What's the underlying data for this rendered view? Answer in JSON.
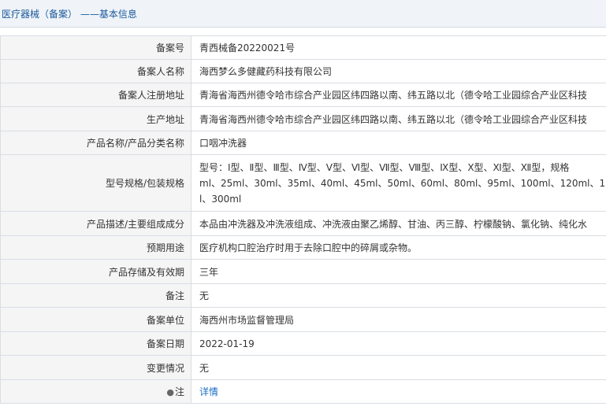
{
  "header": {
    "breadcrumb": "医疗器械（备案） ——基本信息"
  },
  "rows": [
    {
      "label": "备案号",
      "value": "青西械备20220021号"
    },
    {
      "label": "备案人名称",
      "value": "海西梦么多健藏药科技有限公司"
    },
    {
      "label": "备案人注册地址",
      "value": "青海省海西州德令哈市综合产业园区纬四路以南、纬五路以北（德令哈工业园综合产业区科技"
    },
    {
      "label": "生产地址",
      "value": "青海省海西州德令哈市综合产业园区纬四路以南、纬五路以北（德令哈工业园综合产业区科技"
    },
    {
      "label": "产品名称/产品分类名称",
      "value": "口咽冲洗器"
    },
    {
      "label": "型号规格/包装规格",
      "lines": [
        "型号：Ⅰ型、Ⅱ型、Ⅲ型、Ⅳ型、Ⅴ型、Ⅵ型、Ⅶ型、Ⅷ型、Ⅸ型、Ⅹ型、Ⅺ型、Ⅻ型，规格",
        "ml、25ml、30ml、35ml、40ml、45ml、50ml、60ml、80ml、95ml、100ml、120ml、1",
        "l、300ml"
      ]
    },
    {
      "label": "产品描述/主要组成成分",
      "value": "本品由冲洗器及冲洗液组成、冲洗液由聚乙烯醇、甘油、丙三醇、柠檬酸钠、氯化钠、纯化水"
    },
    {
      "label": "预期用途",
      "value": "医疗机构口腔治疗时用于去除口腔中的碎屑或杂物。"
    },
    {
      "label": "产品存储及有效期",
      "value": "三年"
    },
    {
      "label": "备注",
      "value": "无"
    },
    {
      "label": "备案单位",
      "value": "海西州市场监督管理局"
    },
    {
      "label": "备案日期",
      "value": "2022-01-19"
    },
    {
      "label": "变更情况",
      "value": "无"
    },
    {
      "label": "注",
      "value": "详情",
      "icon": "lightbulb-icon"
    }
  ]
}
